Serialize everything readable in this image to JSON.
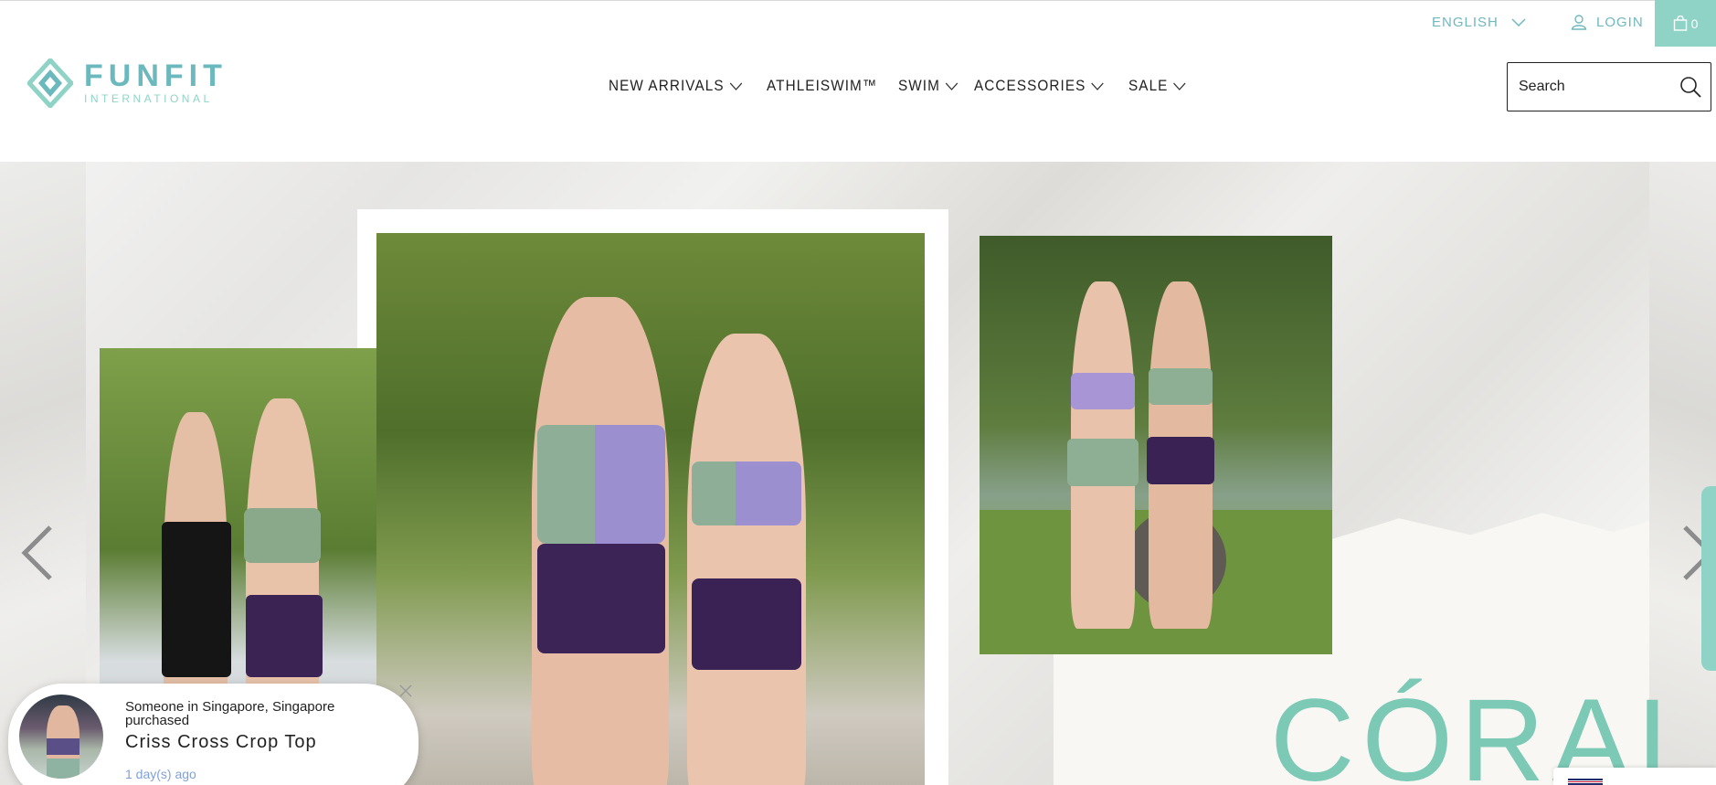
{
  "topbar": {
    "language": "ENGLISH",
    "login": "LOGIN",
    "cart_count": "0"
  },
  "brand": {
    "name": "FUNFIT",
    "tagline": "INTERNATIONAL"
  },
  "nav": [
    {
      "label": "NEW ARRIVALS",
      "has_dropdown": true
    },
    {
      "label": "ATHLEISWIM™",
      "has_dropdown": false
    },
    {
      "label": "SWIM",
      "has_dropdown": true
    },
    {
      "label": "ACCESSORIES",
      "has_dropdown": true
    },
    {
      "label": "SALE",
      "has_dropdown": true
    }
  ],
  "search": {
    "placeholder": "Search"
  },
  "hero": {
    "headline": "CÓRAL"
  },
  "popup": {
    "line1": "Someone in Singapore, Singapore purchased",
    "product": "Criss Cross Crop Top",
    "time": "1 day(s) ago"
  },
  "colors": {
    "brand_teal": "#6bb8bd",
    "mint": "#8ed3c6",
    "coral_text": "#7cc9b6",
    "text_dark": "#222222",
    "time_blue": "#7fa1d9"
  },
  "icons": {
    "language": "chevron-down-icon",
    "login": "user-icon",
    "cart": "shopping-bag-icon",
    "search": "search-icon",
    "prev": "chevron-left-icon",
    "next": "chevron-right-icon",
    "close": "close-icon",
    "flag": "uk-flag-icon"
  }
}
